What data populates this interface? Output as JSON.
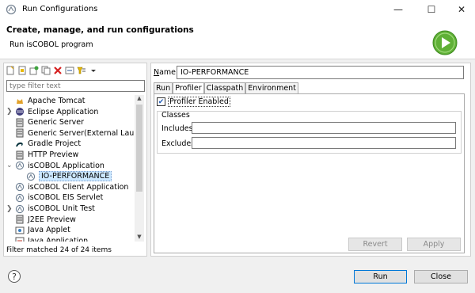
{
  "window": {
    "title": "Run Configurations",
    "minimize": "—",
    "maximize": "☐",
    "close": "✕"
  },
  "header": {
    "title": "Create, manage, and run configurations",
    "subtitle": "Run isCOBOL program"
  },
  "left": {
    "filter_placeholder": "type filter text",
    "tree": [
      {
        "label": "Apache Tomcat",
        "expander": "",
        "icon": "tomcat-icon"
      },
      {
        "label": "Eclipse Application",
        "expander": ">",
        "icon": "eclipse-icon"
      },
      {
        "label": "Generic Server",
        "expander": "",
        "icon": "server-icon"
      },
      {
        "label": "Generic Server(External Launch)",
        "expander": "",
        "icon": "server-icon"
      },
      {
        "label": "Gradle Project",
        "expander": "",
        "icon": "gradle-icon"
      },
      {
        "label": "HTTP Preview",
        "expander": "",
        "icon": "server-icon"
      },
      {
        "label": "isCOBOL Application",
        "expander": "v",
        "icon": "iscobol-icon"
      },
      {
        "label": "IO-PERFORMANCE",
        "expander": "",
        "icon": "iscobol-icon",
        "selected": true
      },
      {
        "label": "isCOBOL Client Application",
        "expander": "",
        "icon": "iscobol-icon"
      },
      {
        "label": "isCOBOL EIS Servlet",
        "expander": "",
        "icon": "iscobol-icon"
      },
      {
        "label": "isCOBOL Unit Test",
        "expander": ">",
        "icon": "iscobol-icon"
      },
      {
        "label": "J2EE Preview",
        "expander": "",
        "icon": "server-icon"
      },
      {
        "label": "Java Applet",
        "expander": "",
        "icon": "applet-icon"
      },
      {
        "label": "Java Application",
        "expander": "",
        "icon": "java-icon"
      }
    ],
    "status": "Filter matched 24 of 24 items"
  },
  "right": {
    "name_label": "Name:",
    "name_value": "IO-PERFORMANCE",
    "tabs": [
      "Run",
      "Profiler",
      "Classpath",
      "Environment"
    ],
    "active_tab": "Profiler",
    "profiler_enabled_label": "Profiler Enabled",
    "profiler_enabled": true,
    "classes_group": "Classes",
    "includes_label": "Includes",
    "excludes_label": "Excludes",
    "revert_label": "Revert",
    "apply_label": "Apply"
  },
  "footer": {
    "run_label": "Run",
    "close_label": "Close",
    "help": "?"
  }
}
